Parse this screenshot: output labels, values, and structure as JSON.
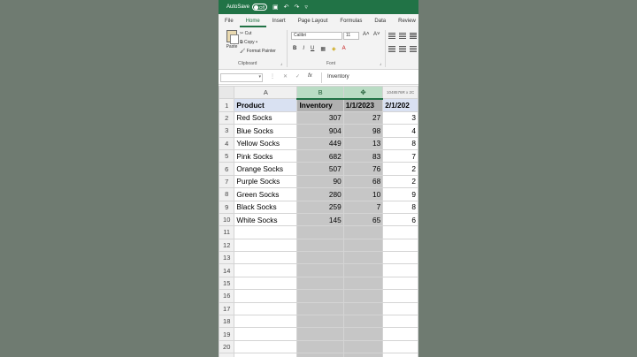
{
  "titlebar": {
    "autosave_label": "AutoSave",
    "autosave_state": "Off"
  },
  "tabs": [
    {
      "label": "File"
    },
    {
      "label": "Home"
    },
    {
      "label": "Insert"
    },
    {
      "label": "Page Layout"
    },
    {
      "label": "Formulas"
    },
    {
      "label": "Data"
    },
    {
      "label": "Review"
    }
  ],
  "ribbon": {
    "paste_label": "Paste",
    "cut_label": "Cut",
    "copy_label": "Copy",
    "format_painter_label": "Format Painter",
    "clipboard_label": "Clipboard",
    "font_name": "Calibri",
    "font_size": "11",
    "font_label": "Font",
    "bold": "B",
    "italic": "I",
    "underline": "U"
  },
  "formula_bar": {
    "namebox": "",
    "cancel": "✕",
    "enter": "✓",
    "fx": "fx",
    "formula": "Inventory"
  },
  "column_headers": [
    "A",
    "B",
    "C",
    "1048576R x 2C"
  ],
  "rows": [
    {
      "n": "1",
      "a": "Product",
      "b": "Inventory",
      "c": "1/1/2023",
      "d": "2/1/202"
    },
    {
      "n": "2",
      "a": "Red Socks",
      "b": "307",
      "c": "27",
      "d": "3"
    },
    {
      "n": "3",
      "a": "Blue Socks",
      "b": "904",
      "c": "98",
      "d": "4"
    },
    {
      "n": "4",
      "a": "Yellow Socks",
      "b": "449",
      "c": "13",
      "d": "8"
    },
    {
      "n": "5",
      "a": "Pink Socks",
      "b": "682",
      "c": "83",
      "d": "7"
    },
    {
      "n": "6",
      "a": "Orange Socks",
      "b": "507",
      "c": "76",
      "d": "2"
    },
    {
      "n": "7",
      "a": "Purple Socks",
      "b": "90",
      "c": "68",
      "d": "2"
    },
    {
      "n": "8",
      "a": "Green Socks",
      "b": "280",
      "c": "10",
      "d": "9"
    },
    {
      "n": "9",
      "a": "Black Socks",
      "b": "259",
      "c": "7",
      "d": "8"
    },
    {
      "n": "10",
      "a": "White Socks",
      "b": "145",
      "c": "65",
      "d": "6"
    },
    {
      "n": "11",
      "a": "",
      "b": "",
      "c": "",
      "d": ""
    },
    {
      "n": "12",
      "a": "",
      "b": "",
      "c": "",
      "d": ""
    },
    {
      "n": "13",
      "a": "",
      "b": "",
      "c": "",
      "d": ""
    },
    {
      "n": "14",
      "a": "",
      "b": "",
      "c": "",
      "d": ""
    },
    {
      "n": "15",
      "a": "",
      "b": "",
      "c": "",
      "d": ""
    },
    {
      "n": "16",
      "a": "",
      "b": "",
      "c": "",
      "d": ""
    },
    {
      "n": "17",
      "a": "",
      "b": "",
      "c": "",
      "d": ""
    },
    {
      "n": "18",
      "a": "",
      "b": "",
      "c": "",
      "d": ""
    },
    {
      "n": "19",
      "a": "",
      "b": "",
      "c": "",
      "d": ""
    },
    {
      "n": "20",
      "a": "",
      "b": "",
      "c": "",
      "d": ""
    },
    {
      "n": "21",
      "a": "",
      "b": "",
      "c": "",
      "d": ""
    }
  ],
  "colors": {
    "excel_green": "#217346",
    "selection": "#c6c6c6",
    "header_fill": "#d9e1f2",
    "background": "#6f7b71"
  }
}
